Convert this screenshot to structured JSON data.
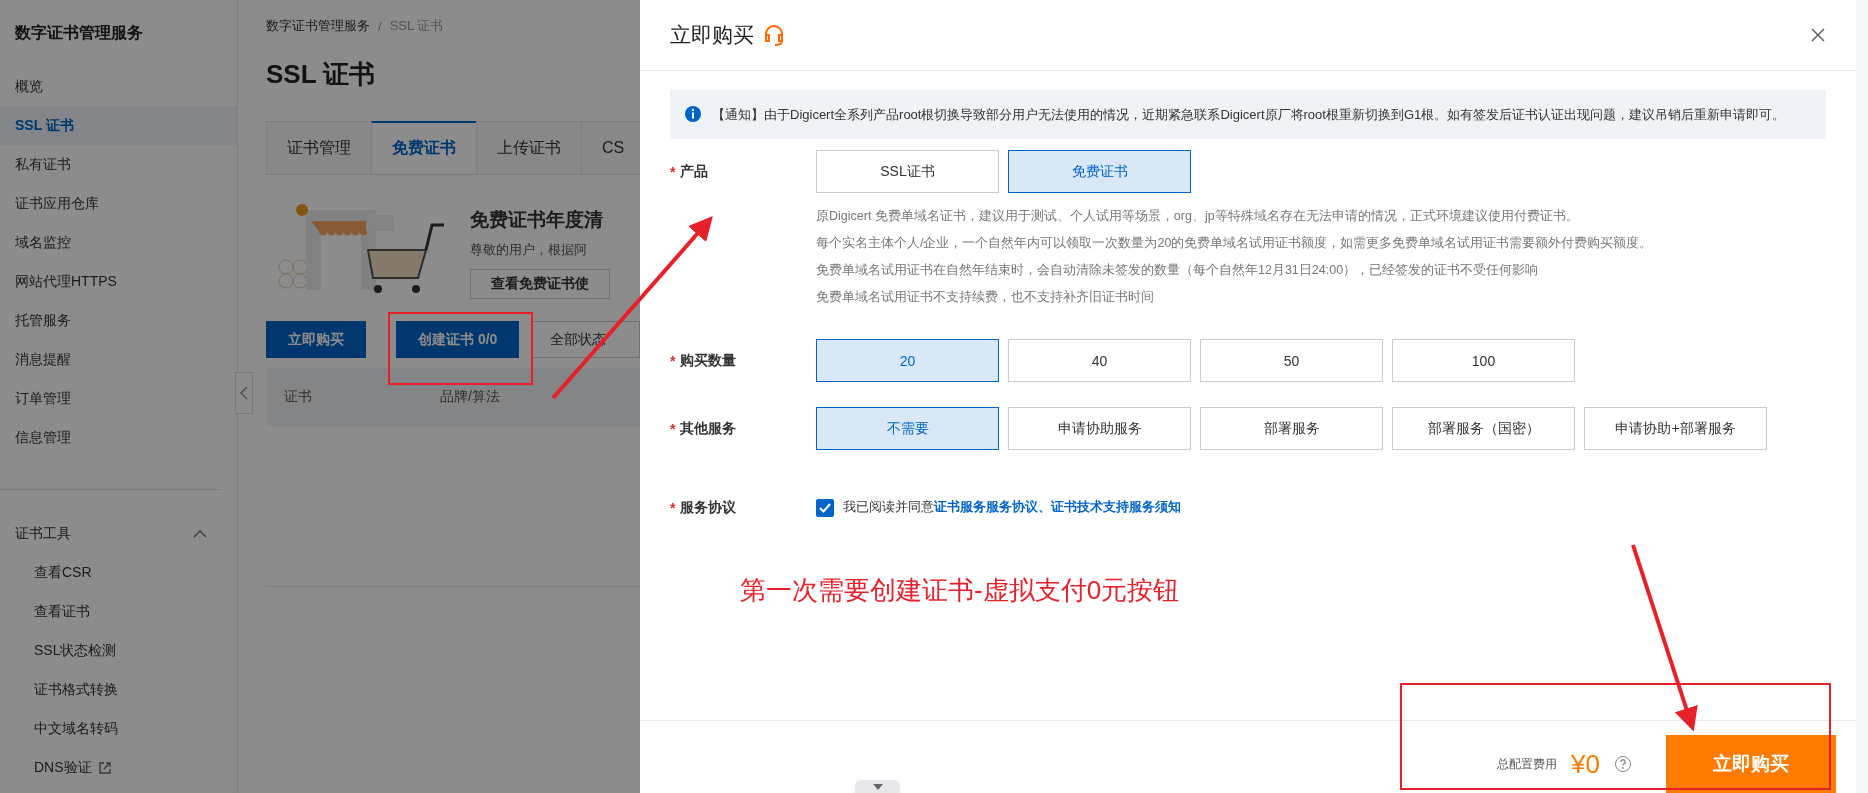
{
  "sidebar": {
    "title": "数字证书管理服务",
    "items": [
      {
        "label": "概览",
        "selected": false
      },
      {
        "label": "SSL 证书",
        "selected": true
      },
      {
        "label": "私有证书",
        "selected": false
      },
      {
        "label": "证书应用仓库",
        "selected": false
      },
      {
        "label": "域名监控",
        "selected": false
      },
      {
        "label": "网站代理HTTPS",
        "selected": false
      },
      {
        "label": "托管服务",
        "selected": false
      },
      {
        "label": "消息提醒",
        "selected": false
      },
      {
        "label": "订单管理",
        "selected": false
      },
      {
        "label": "信息管理",
        "selected": false
      }
    ],
    "tools_group": {
      "label": "证书工具",
      "expanded": true,
      "children": [
        {
          "label": "查看CSR",
          "external": false
        },
        {
          "label": "查看证书",
          "external": false
        },
        {
          "label": "SSL状态检测",
          "external": false
        },
        {
          "label": "证书格式转换",
          "external": false
        },
        {
          "label": "中文域名转码",
          "external": false
        },
        {
          "label": "DNS验证",
          "external": true
        }
      ]
    }
  },
  "main": {
    "breadcrumb": [
      "数字证书管理服务",
      "SSL 证书"
    ],
    "breadcrumb_separator": "/",
    "title": "SSL 证书",
    "tabs": [
      {
        "label": "证书管理",
        "selected": false
      },
      {
        "label": "免费证书",
        "selected": true
      },
      {
        "label": "上传证书",
        "selected": false
      },
      {
        "label": "CS",
        "selected": false
      }
    ],
    "banner": {
      "heading": "免费证书年度清",
      "text": "尊敬的用户，根据阿",
      "button": "查看免费证书使"
    },
    "actions": [
      {
        "kind": "button",
        "label": "立即购买"
      },
      {
        "kind": "button",
        "label": "创建证书 0/0"
      },
      {
        "kind": "dropdown",
        "label": "全部状态"
      }
    ],
    "table": {
      "columns": [
        "证书",
        "品牌/算法"
      ]
    }
  },
  "dialog": {
    "title": "立即购买",
    "notice": "【通知】由于Digicert全系列产品root根切换导致部分用户无法使用的情况，近期紧急联系Digicert原厂将root根重新切换到G1根。如有签发后证书认证出现问题，建议吊销后重新申请即可。",
    "rows": [
      {
        "kind": "options",
        "required_mark": "*",
        "label": "产品",
        "options": [
          {
            "label": "SSL证书",
            "selected": false
          },
          {
            "label": "免费证书",
            "selected": true
          }
        ],
        "description": [
          "原Digicert 免费单域名证书，建议用于测试、个人试用等场景，org、jp等特殊域名存在无法申请的情况，正式环境建议使用付费证书。",
          "每个实名主体个人/企业，一个自然年内可以领取一次数量为20的免费单域名试用证书额度，如需更多免费单域名试用证书需要额外付费购买额度。",
          "免费单域名试用证书在自然年结束时，会自动清除未签发的数量（每个自然年12月31日24:00），已经签发的证书不受任何影响",
          "免费单域名试用证书不支持续费，也不支持补齐旧证书时间"
        ]
      },
      {
        "kind": "options",
        "required_mark": "*",
        "label": "购买数量",
        "options": [
          {
            "label": "20",
            "selected": true
          },
          {
            "label": "40",
            "selected": false
          },
          {
            "label": "50",
            "selected": false
          },
          {
            "label": "100",
            "selected": false
          }
        ]
      },
      {
        "kind": "options",
        "required_mark": "*",
        "label": "其他服务",
        "options": [
          {
            "label": "不需要",
            "selected": true
          },
          {
            "label": "申请协助服务",
            "selected": false
          },
          {
            "label": "部署服务",
            "selected": false
          },
          {
            "label": "部署服务（国密）",
            "selected": false
          },
          {
            "label": "申请协助+部署服务",
            "selected": false
          }
        ]
      },
      {
        "kind": "checkbox",
        "required_mark": "*",
        "label": "服务协议",
        "checked": true,
        "text": "我已阅读并同意",
        "link": "证书服务服务协议、证书技术支持服务须知"
      }
    ],
    "annotation": "第一次需要创建证书-虚拟支付0元按钮",
    "footer": {
      "total_label": "总配置费用",
      "price": "¥0",
      "buy_button": "立即购买"
    }
  }
}
